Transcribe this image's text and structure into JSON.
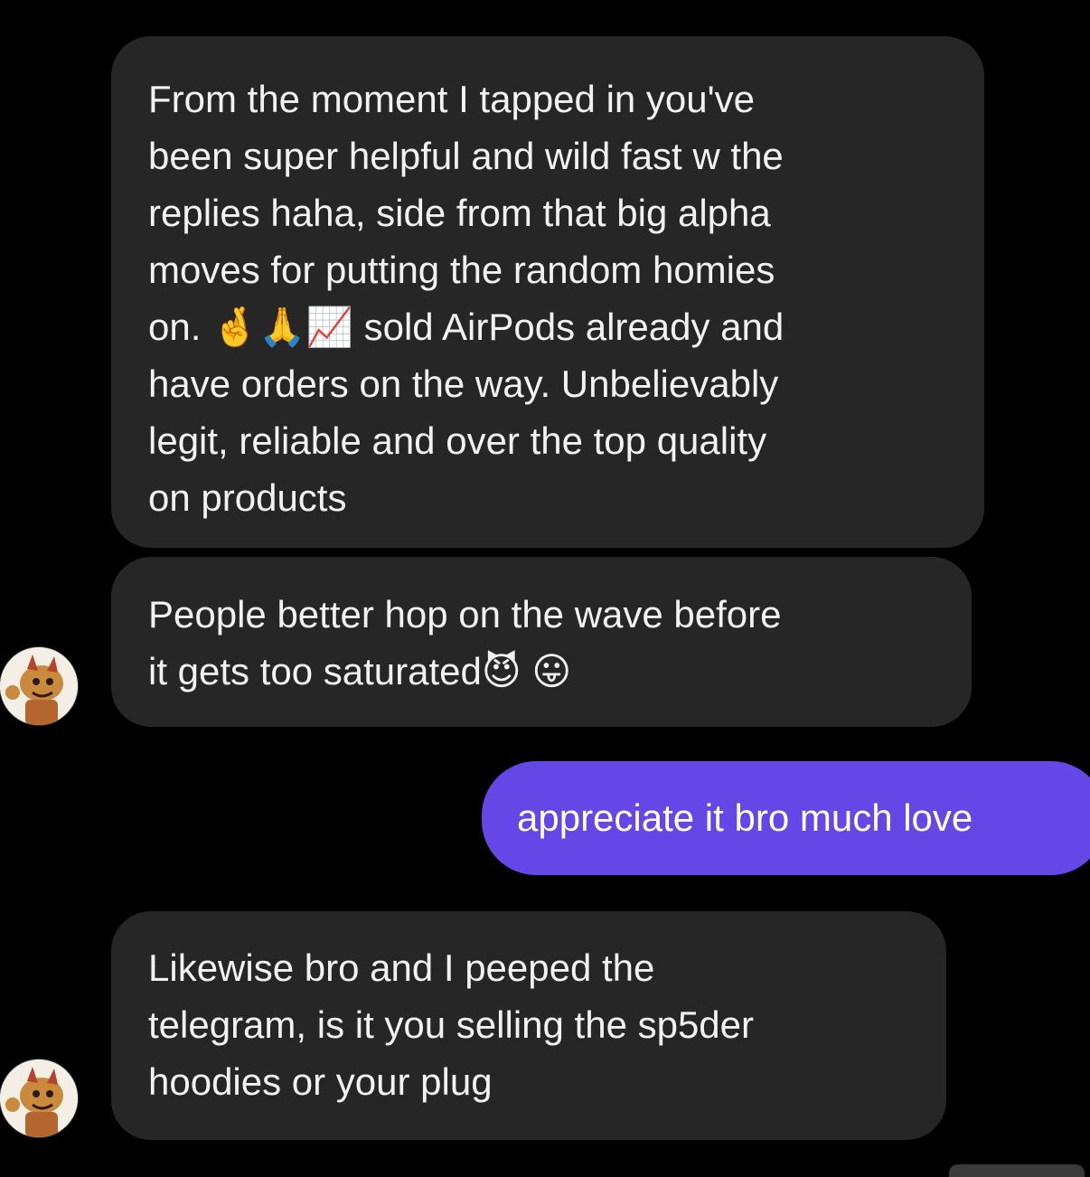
{
  "conversation": {
    "messages": [
      {
        "sender": "other",
        "text": "From the moment I tapped in you've\nbeen super helpful and wild fast w the\nreplies haha, side from that big alpha\nmoves for putting the random homies\non. 🤞🙏📈 sold AirPods already and\nhave orders on the way. Unbelievably\nlegit, reliable and over the top quality\non products"
      },
      {
        "sender": "other",
        "text": "People better hop on the wave before\nit gets too saturated😈 😛"
      },
      {
        "sender": "me",
        "text": "appreciate it bro much love"
      },
      {
        "sender": "other",
        "text": "Likewise bro and I peeped the\ntelegram, is it you selling the sp5der\nhoodies or your plug"
      }
    ]
  },
  "colors": {
    "background": "#000000",
    "received_bubble": "#262626",
    "sent_bubble": "#6447e6",
    "text": "#f2f2f2"
  },
  "icons": {
    "avatar": "cartoon-avatar-icon"
  }
}
